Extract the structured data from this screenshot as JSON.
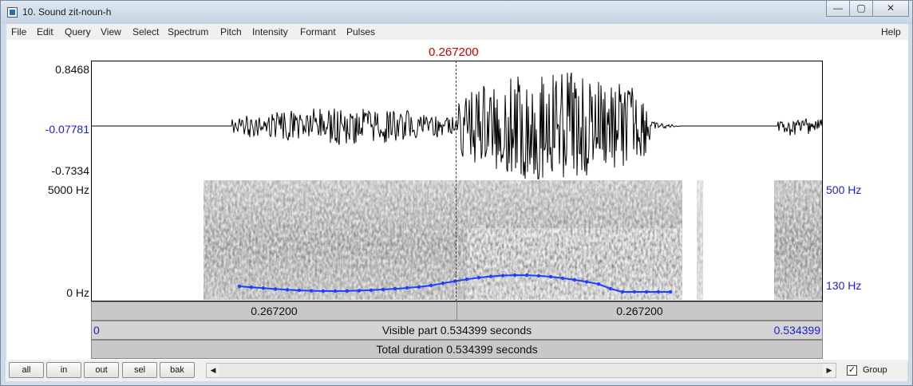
{
  "window": {
    "title": "10. Sound zit-noun-h",
    "controls": {
      "minimize": "—",
      "maximize": "▢",
      "close": "✕"
    }
  },
  "menu": [
    "File",
    "Edit",
    "Query",
    "View",
    "Select",
    "Spectrum",
    "Pitch",
    "Intensity",
    "Formant",
    "Pulses"
  ],
  "help_label": "Help",
  "cursor": {
    "time_label": "0.267200",
    "time_s": 0.2672,
    "color": "#d40000"
  },
  "waveform": {
    "max_label": "0.8468",
    "cursor_value_label": "-0.07781",
    "min_label": "-0.7334"
  },
  "spectrogram": {
    "top_label": "5000 Hz",
    "bottom_label": "0 Hz",
    "pitch_top_label": "500 Hz",
    "pitch_bottom_label": "130 Hz",
    "pitch_color": "#1e3fff"
  },
  "selection_bar": {
    "left_value": "0.267200",
    "right_value": "0.267200"
  },
  "visible_bar": {
    "start": "0",
    "text": "Visible part 0.534399 seconds",
    "end": "0.534399"
  },
  "total_bar": {
    "text": "Total duration 0.534399 seconds"
  },
  "bottom_buttons": [
    "all",
    "in",
    "out",
    "sel",
    "bak"
  ],
  "scroll": {
    "left_arrow": "◀",
    "right_arrow": "▶"
  },
  "group": {
    "label": "Group",
    "checked": true,
    "check_mark": "✓"
  }
}
